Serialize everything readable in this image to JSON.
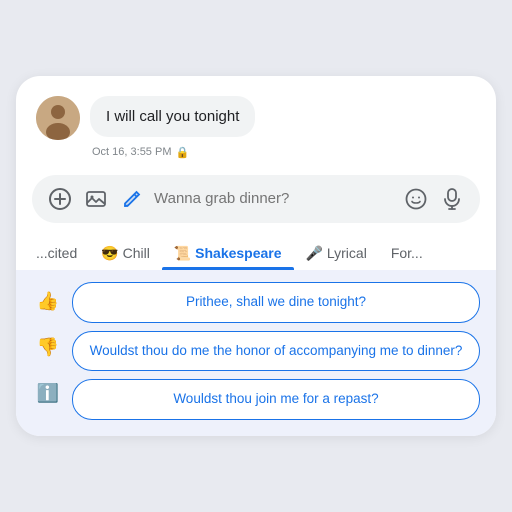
{
  "message": {
    "bubble_text": "I will call you tonight",
    "timestamp": "Oct 16, 3:55 PM",
    "lock": "🔒"
  },
  "input": {
    "placeholder": "Wanna grab dinner?"
  },
  "tabs": [
    {
      "id": "excited",
      "label": "...cited",
      "emoji": "",
      "active": false
    },
    {
      "id": "chill",
      "label": "Chill",
      "emoji": "😎",
      "active": false
    },
    {
      "id": "shakespeare",
      "label": "Shakespeare",
      "emoji": "📜",
      "active": true
    },
    {
      "id": "lyrical",
      "label": "Lyrical",
      "emoji": "🎤",
      "active": false
    },
    {
      "id": "for",
      "label": "For...",
      "emoji": "",
      "active": false
    }
  ],
  "suggestions": [
    "Prithee, shall we dine tonight?",
    "Wouldst thou do me the honor of accompanying me to dinner?",
    "Wouldst thou join me for a repast?"
  ],
  "side_actions": {
    "thumbs_up": "👍",
    "thumbs_down": "👎",
    "info": "ℹ️"
  },
  "icons": {
    "add": "+",
    "image": "🖼",
    "edit": "✏️",
    "emoji": "🙂",
    "mic": "🎤"
  }
}
